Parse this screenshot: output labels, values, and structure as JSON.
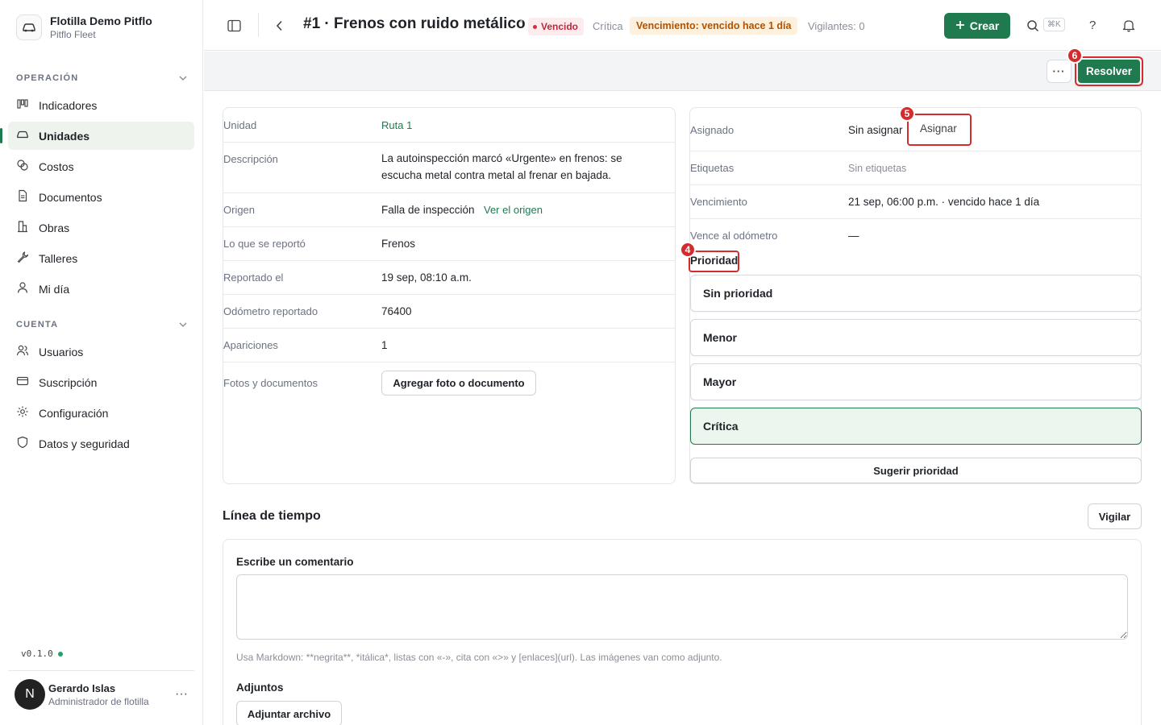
{
  "org": {
    "name": "Flotilla Demo Pitflo",
    "sub": "Pitflo Fleet"
  },
  "sidebar": {
    "sections": [
      {
        "title": "OPERACIÓN"
      },
      {
        "title": "CUENTA"
      }
    ],
    "operacion_items": [
      {
        "label": "Indicadores",
        "icon": "chart-icon"
      },
      {
        "label": "Unidades",
        "icon": "car-icon",
        "active": true
      },
      {
        "label": "Costos",
        "icon": "coins-icon"
      },
      {
        "label": "Documentos",
        "icon": "document-icon"
      },
      {
        "label": "Obras",
        "icon": "building-icon"
      },
      {
        "label": "Talleres",
        "icon": "wrench-icon"
      },
      {
        "label": "Mi día",
        "icon": "person-icon"
      }
    ],
    "cuenta_items": [
      {
        "label": "Usuarios",
        "icon": "users-icon"
      },
      {
        "label": "Suscripción",
        "icon": "card-icon"
      },
      {
        "label": "Configuración",
        "icon": "gear-icon"
      },
      {
        "label": "Datos y seguridad",
        "icon": "shield-icon"
      }
    ],
    "version": "v0.1.0",
    "user": {
      "initial": "N",
      "name": "Gerardo Islas",
      "role": "Administrador de flotilla"
    }
  },
  "header": {
    "title": "#1 · Frenos con ruido metálico",
    "status": "Vencido",
    "priority": "Crítica",
    "due": "Vencimiento: vencido hace 1 día",
    "watchers": "Vigilantes: 0",
    "create_label": "Crear",
    "shortcut": "⌘K",
    "help": "?"
  },
  "actions": {
    "more": "···",
    "resolve": "Resolver"
  },
  "markers": {
    "prioridad": "4",
    "asignar": "5",
    "resolver": "6"
  },
  "details": {
    "unidad_label": "Unidad",
    "unidad_value": "Ruta 1",
    "descripcion_label": "Descripción",
    "descripcion_line1": "La autoinspección marcó «Urgente» en frenos: se",
    "descripcion_line2": "escucha metal contra metal al frenar en bajada.",
    "origen_label": "Origen",
    "origen_value": "Falla de inspección",
    "origen_link": "Ver el origen",
    "reportado_que_label": "Lo que se reportó",
    "reportado_que_value": "Frenos",
    "reportado_el_label": "Reportado el",
    "reportado_el_value": "19 sep, 08:10 a.m.",
    "odometro_label": "Odómetro reportado",
    "odometro_value": "76400",
    "apariciones_label": "Apariciones",
    "apariciones_value": "1",
    "fotos_label": "Fotos y documentos",
    "fotos_button": "Agregar foto o documento"
  },
  "assign": {
    "asignado_label": "Asignado",
    "asignado_value": "Sin asignar",
    "asignar_button": "Asignar",
    "etiquetas_label": "Etiquetas",
    "etiquetas_value": "Sin etiquetas",
    "vencimiento_label": "Vencimiento",
    "vencimiento_value": "21 sep, 06:00 p.m. · vencido hace 1 día",
    "vence_odo_label": "Vence al odómetro",
    "vence_odo_value": "—",
    "prioridad_label": "Prioridad",
    "priority_options": [
      "Sin prioridad",
      "Menor",
      "Mayor",
      "Crítica"
    ],
    "selected_priority": "Crítica",
    "suggest_button": "Sugerir prioridad"
  },
  "timeline": {
    "title": "Línea de tiempo",
    "watch_button": "Vigilar",
    "comment_label": "Escribe un comentario",
    "comment_value": "",
    "markdown_hint": "Usa Markdown: **negrita**, *itálica*, listas con «-», cita con «>» y [enlaces](url). Las imágenes van como adjunto.",
    "attachments_label": "Adjuntos",
    "attach_button": "Adjuntar archivo"
  },
  "colors": {
    "accent": "#1f7a4f",
    "danger": "#d42c2c",
    "warning_bg": "#fdf0dc"
  }
}
